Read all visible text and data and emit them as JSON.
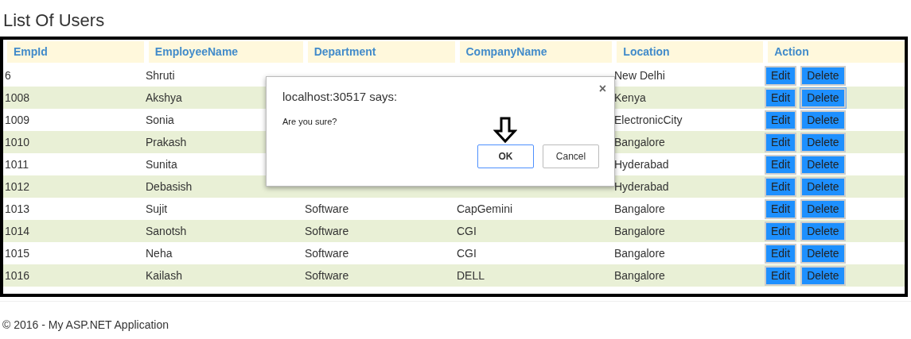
{
  "page_title": "List Of Users",
  "table": {
    "columns": [
      "EmpId",
      "EmployeeName",
      "Department",
      "CompanyName",
      "Location",
      "Action"
    ],
    "rows": [
      {
        "empid": "6",
        "name": "Shruti",
        "location": "New Delhi",
        "edit": "Edit",
        "delete": "Delete",
        "delete_focused": false
      },
      {
        "empid": "1008",
        "name": "Akshya",
        "location": "Kenya",
        "edit": "Edit",
        "delete": "Delete",
        "delete_focused": true
      },
      {
        "empid": "1009",
        "name": "Sonia",
        "location": "ElectronicCity",
        "edit": "Edit",
        "delete": "Delete",
        "delete_focused": false
      },
      {
        "empid": "1010",
        "name": "Prakash",
        "location": "Bangalore",
        "edit": "Edit",
        "delete": "Delete",
        "delete_focused": false
      },
      {
        "empid": "1011",
        "name": "Sunita",
        "location": "Hyderabad",
        "edit": "Edit",
        "delete": "Delete",
        "delete_focused": false
      },
      {
        "empid": "1012",
        "name": "Debasish",
        "location": "Hyderabad",
        "edit": "Edit",
        "delete": "Delete",
        "delete_focused": false
      },
      {
        "empid": "1013",
        "name": "Sujit",
        "department": "Software",
        "company": "CapGemini",
        "location": "Bangalore",
        "edit": "Edit",
        "delete": "Delete",
        "delete_focused": false
      },
      {
        "empid": "1014",
        "name": "Sanotsh",
        "department": "Software",
        "company": "CGI",
        "location": "Bangalore",
        "edit": "Edit",
        "delete": "Delete",
        "delete_focused": false
      },
      {
        "empid": "1015",
        "name": "Neha",
        "department": "Software",
        "company": "CGI",
        "location": "Bangalore",
        "edit": "Edit",
        "delete": "Delete",
        "delete_focused": false
      },
      {
        "empid": "1016",
        "name": "Kailash",
        "department": "Software",
        "company": "DELL",
        "location": "Bangalore",
        "edit": "Edit",
        "delete": "Delete",
        "delete_focused": false
      }
    ]
  },
  "dialog": {
    "title": "localhost:30517 says:",
    "message": "Are you sure?",
    "close": "×",
    "buttons": [
      {
        "label": "OK",
        "focused": true
      },
      {
        "label": "Cancel",
        "focused": false
      }
    ]
  },
  "footer": "© 2016 - My ASP.NET Application"
}
